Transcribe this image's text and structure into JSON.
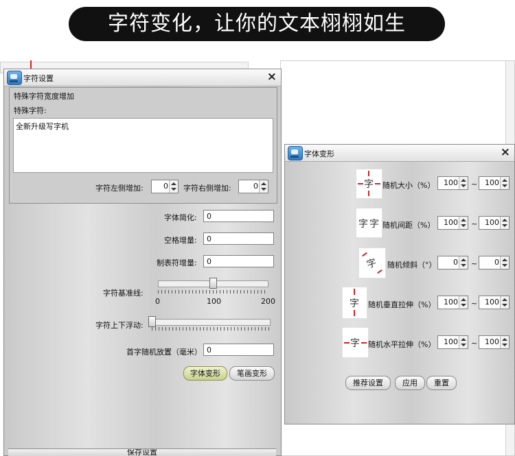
{
  "banner": {
    "text": "字符变化，让你的文本栩栩如生"
  },
  "left_window": {
    "title": "字符设置",
    "group_title": "特殊字符宽度增加",
    "special_label": "特殊字符:",
    "special_text": "全新升级写字机",
    "left_add_label": "字符左侧增加:",
    "left_add_value": "0",
    "right_add_label": "字符右侧增加:",
    "right_add_value": "0",
    "simplify_label": "字体简化:",
    "simplify_value": "0",
    "space_label": "空格增量:",
    "space_value": "0",
    "tab_label": "制表符增量:",
    "tab_value": "0",
    "baseline_label": "字符基准线:",
    "baseline_slider": {
      "min": 0,
      "max": 200,
      "value": 100,
      "tick_min": "0",
      "tick_mid": "100",
      "tick_max": "200"
    },
    "float_label": "字符上下浮动:",
    "float_slider": {
      "min": 0,
      "max": 100,
      "value": 0
    },
    "first_random_label": "首字随机放置（毫米）",
    "first_random_value": "0",
    "font_transform_btn": "字体变形",
    "stroke_transform_btn": "笔画变形",
    "bottom_section": "保存设置"
  },
  "right_window": {
    "title": "字体变形",
    "rows": [
      {
        "icon": "size-icon",
        "label": "随机大小（%）",
        "min": "100",
        "max": "100"
      },
      {
        "icon": "spacing-icon",
        "label": "随机间距（%）",
        "min": "100",
        "max": "100"
      },
      {
        "icon": "tilt-icon",
        "label": "随机倾斜（°）",
        "min": "0",
        "max": "0"
      },
      {
        "icon": "vstretch-icon",
        "label": "随机垂直拉伸（%）",
        "min": "100",
        "max": "100"
      },
      {
        "icon": "hstretch-icon",
        "label": "随机水平拉伸（%）",
        "min": "100",
        "max": "100"
      }
    ],
    "range_sep": "~",
    "glyph": "字",
    "recommend_btn": "推荐设置",
    "apply_btn": "应用",
    "reset_btn": "重置"
  }
}
